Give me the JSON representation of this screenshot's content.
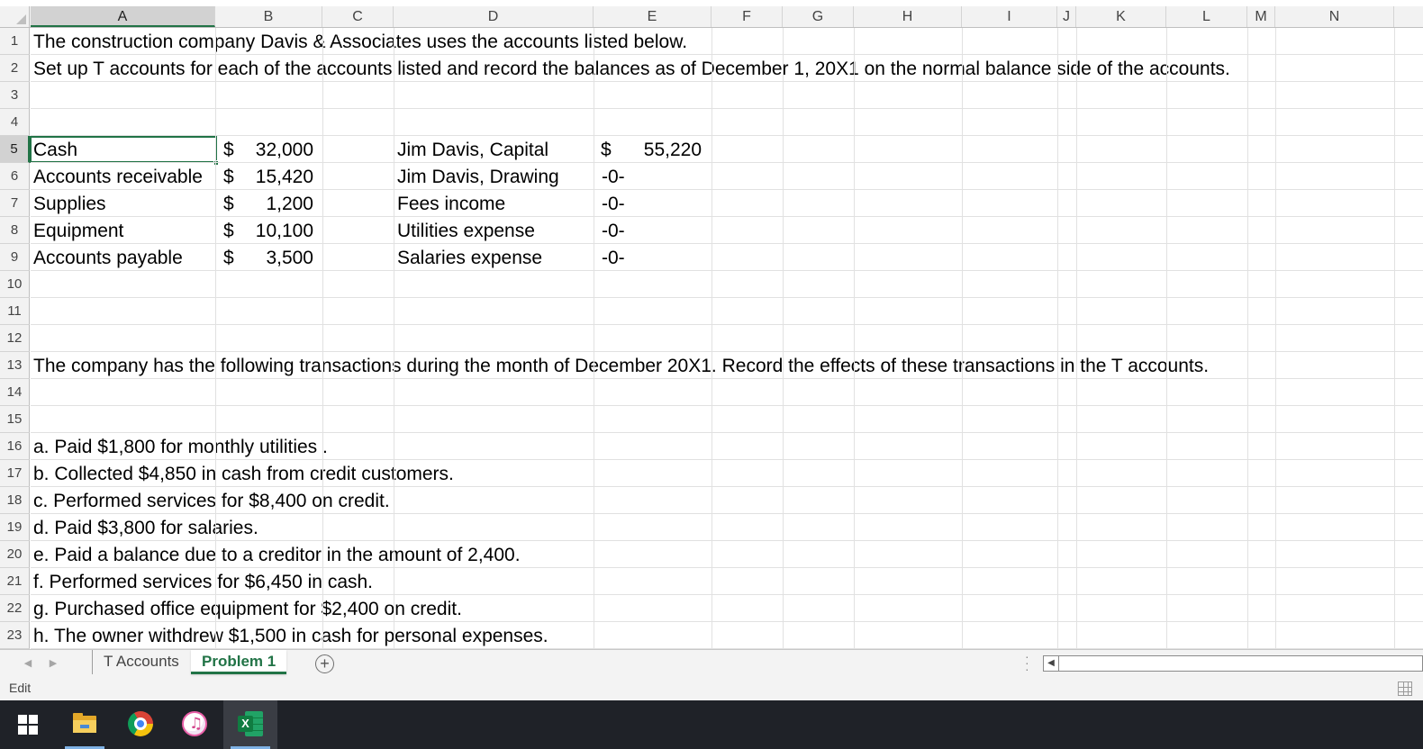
{
  "columns": [
    "A",
    "B",
    "C",
    "D",
    "E",
    "F",
    "G",
    "H",
    "I",
    "J",
    "K",
    "L",
    "M",
    "N"
  ],
  "active_column": "A",
  "active_row": "5",
  "rows": [
    {
      "n": "1"
    },
    {
      "n": "2"
    },
    {
      "n": "3"
    },
    {
      "n": "4"
    },
    {
      "n": "5"
    },
    {
      "n": "6"
    },
    {
      "n": "7"
    },
    {
      "n": "8"
    },
    {
      "n": "9"
    },
    {
      "n": "10"
    },
    {
      "n": "11"
    },
    {
      "n": "12"
    },
    {
      "n": "13"
    },
    {
      "n": "14"
    },
    {
      "n": "15"
    },
    {
      "n": "16"
    },
    {
      "n": "17"
    },
    {
      "n": "18"
    },
    {
      "n": "19"
    },
    {
      "n": "20"
    },
    {
      "n": "21"
    },
    {
      "n": "22"
    },
    {
      "n": "23"
    }
  ],
  "intro": {
    "line1": "The construction company Davis & Associates uses the accounts listed below.",
    "line2": "Set up T accounts for each of the accounts listed and record the balances as of December 1, 20X1 on the normal balance side of the accounts."
  },
  "accounts_left": [
    {
      "name": "Cash",
      "currency": "$",
      "amount": "32,000"
    },
    {
      "name": "Accounts receivable",
      "currency": "$",
      "amount": "15,420"
    },
    {
      "name": "Supplies",
      "currency": "$",
      "amount": "1,200"
    },
    {
      "name": "Equipment",
      "currency": "$",
      "amount": "10,100"
    },
    {
      "name": "Accounts payable",
      "currency": "$",
      "amount": "3,500"
    }
  ],
  "accounts_right": [
    {
      "name": "Jim Davis, Capital",
      "currency": "$",
      "amount": "55,220"
    },
    {
      "name": "Jim Davis, Drawing",
      "currency": "",
      "amount": "-0-"
    },
    {
      "name": "Fees income",
      "currency": "",
      "amount": "-0-"
    },
    {
      "name": "Utilities expense",
      "currency": "",
      "amount": "-0-"
    },
    {
      "name": "Salaries expense",
      "currency": "",
      "amount": "-0-"
    }
  ],
  "transactions_intro": "The company has the following transactions during the month of December 20X1. Record the effects of these transactions in the T accounts.",
  "transactions": [
    "a. Paid $1,800 for monthly utilities .",
    "b. Collected $4,850 in cash from credit customers.",
    "c. Performed services for $8,400 on credit.",
    "d. Paid $3,800 for salaries.",
    "e. Paid a balance due to a creditor in the amount of 2,400.",
    "f. Performed services for $6,450 in cash.",
    "g. Purchased office equipment for $2,400 on credit.",
    "h. The owner withdrew $1,500 in cash for personal expenses."
  ],
  "sheet_tabs": [
    {
      "label": "T Accounts",
      "active": false
    },
    {
      "label": "Problem 1",
      "active": true
    }
  ],
  "status": {
    "mode": "Edit"
  },
  "taskbar": {
    "items": [
      "windows-start",
      "file-explorer",
      "chrome",
      "itunes",
      "excel"
    ],
    "excel_badge": "X"
  },
  "colors": {
    "accent": "#217346",
    "taskbar": "#1f2228"
  }
}
